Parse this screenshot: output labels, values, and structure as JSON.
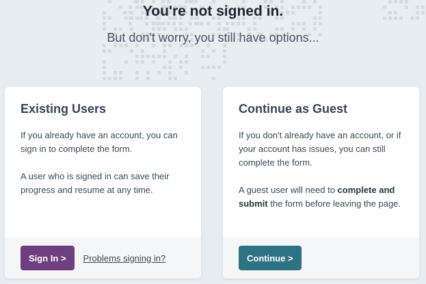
{
  "header": {
    "title": "You're not signed in.",
    "subtitle": "But don't worry, you still have options..."
  },
  "existing": {
    "title": "Existing Users",
    "para1": "If you already have an account, you can sign in to complete the form.",
    "para2": "A user who is signed in can save their progress and resume at any time.",
    "button": "Sign In >",
    "link": "Problems signing in?"
  },
  "guest": {
    "title": "Continue as Guest",
    "para1": "If you don't already have an account, or if your account has issues, you can still complete the form.",
    "para2_pre": "A guest user will need to ",
    "para2_bold1": "complete and submit",
    "para2_post": " the form before leaving the page.",
    "button": "Continue >"
  },
  "colors": {
    "background": "#e8edf1",
    "signin_button": "#6e3f7e",
    "guest_button": "#2e7384"
  }
}
